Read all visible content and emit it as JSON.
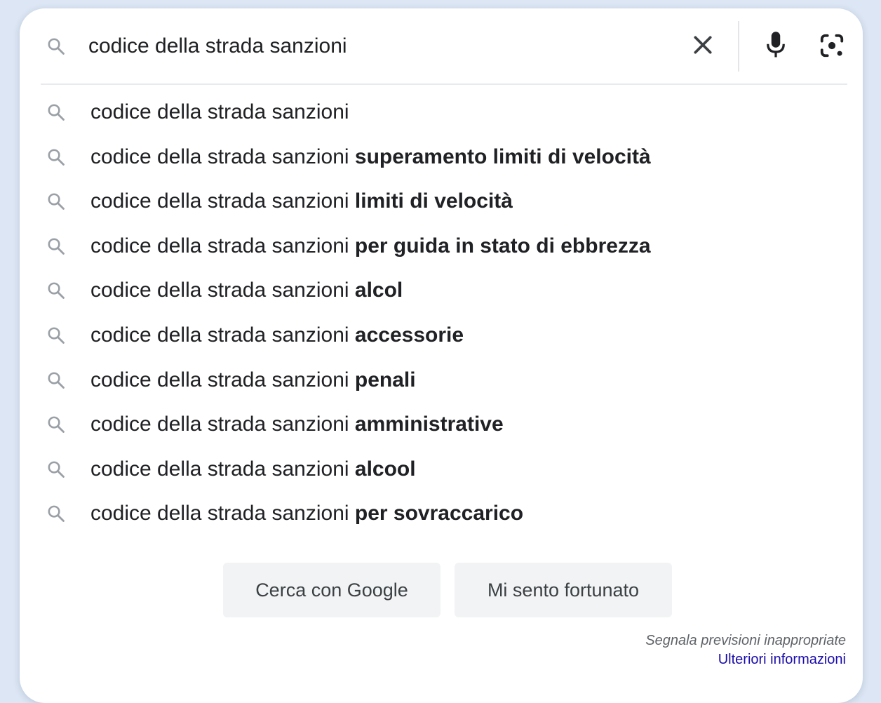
{
  "search": {
    "query": "codice della strada sanzioni",
    "icons": {
      "lead": "search-icon",
      "clear": "close-icon",
      "voice": "microphone-icon",
      "image": "camera-lens-icon"
    }
  },
  "suggestions": [
    {
      "prefix": "codice della strada sanzioni",
      "completion": ""
    },
    {
      "prefix": "codice della strada sanzioni ",
      "completion": "superamento limiti di velocità"
    },
    {
      "prefix": "codice della strada sanzioni ",
      "completion": "limiti di velocità"
    },
    {
      "prefix": "codice della strada sanzioni ",
      "completion": "per guida in stato di ebbrezza"
    },
    {
      "prefix": "codice della strada sanzioni ",
      "completion": "alcol"
    },
    {
      "prefix": "codice della strada sanzioni ",
      "completion": "accessorie"
    },
    {
      "prefix": "codice della strada sanzioni ",
      "completion": "penali"
    },
    {
      "prefix": "codice della strada sanzioni ",
      "completion": "amministrative"
    },
    {
      "prefix": "codice della strada sanzioni ",
      "completion": "alcool"
    },
    {
      "prefix": "codice della strada sanzioni ",
      "completion": "per sovraccarico"
    }
  ],
  "buttons": {
    "search_label": "Cerca con Google",
    "lucky_label": "Mi sento fortunato"
  },
  "footer": {
    "report_label": "Segnala previsioni inappropriate",
    "more_info_label": "Ulteriori informazioni"
  },
  "colors": {
    "background": "#dce6f4",
    "panel": "#ffffff",
    "text": "#202124",
    "icon_gray": "#9aa0a6",
    "link": "#1a0dab",
    "button_bg": "#f1f3f5"
  }
}
